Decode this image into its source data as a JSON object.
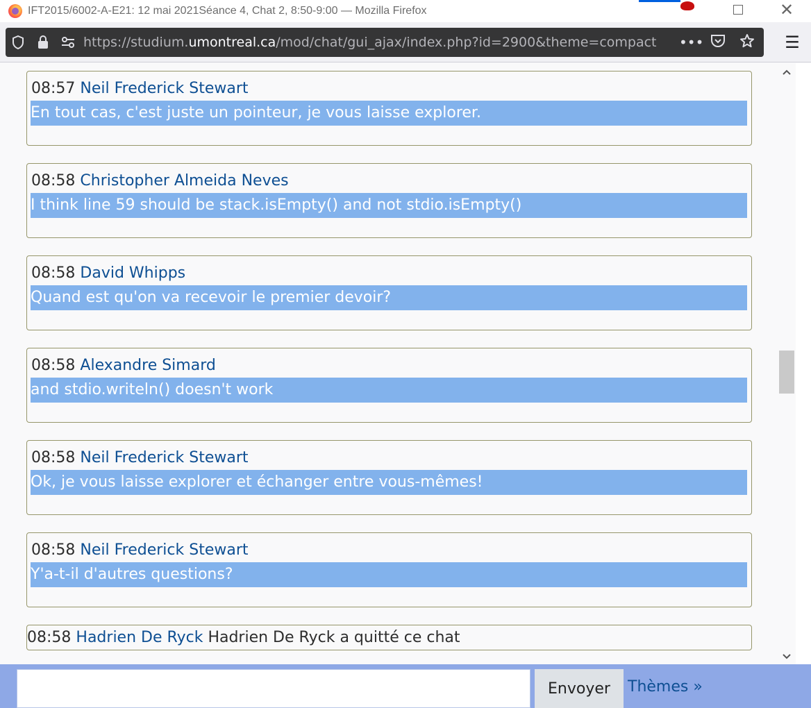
{
  "window": {
    "title": "IFT2015/6002-A-E21: 12 mai 2021Séance 4, Chat 2, 8:50-9:00 — Mozilla Firefox",
    "maximize_icon": "maximize-icon",
    "close_icon": "close-icon"
  },
  "urlbar": {
    "url_prefix": "https://studium.",
    "url_host": "umontreal.ca",
    "url_path": "/mod/chat/gui_ajax/index.php?id=2900&theme=compact",
    "icons": [
      "shield-icon",
      "lock-icon",
      "permissions-icon",
      "more-actions-icon",
      "pocket-icon",
      "bookmark-star-icon",
      "hamburger-menu-icon"
    ]
  },
  "messages": [
    {
      "time": "08:57",
      "user": "Neil Frederick Stewart",
      "text": "En tout cas, c'est juste un pointeur, je vous laisse explorer."
    },
    {
      "time": "08:58",
      "user": "Christopher Almeida Neves",
      "text": "I think line 59 should be stack.isEmpty() and not stdio.isEmpty()"
    },
    {
      "time": "08:58",
      "user": "David Whipps",
      "text": "Quand est qu'on va recevoir le premier devoir?"
    },
    {
      "time": "08:58",
      "user": "Alexandre Simard",
      "text": "and stdio.writeln() doesn't work"
    },
    {
      "time": "08:58",
      "user": "Neil Frederick Stewart",
      "text": "Ok, je vous laisse explorer et échanger entre vous-mêmes!"
    },
    {
      "time": "08:58",
      "user": "Neil Frederick Stewart",
      "text": "Y'a-t-il d'autres questions?"
    }
  ],
  "system_message": {
    "time": "08:58",
    "user": "Hadrien De Ryck",
    "text": "Hadrien De Ryck a quitté ce chat"
  },
  "footer": {
    "input_value": "",
    "send_label": "Envoyer",
    "themes_label": "Thèmes »"
  }
}
